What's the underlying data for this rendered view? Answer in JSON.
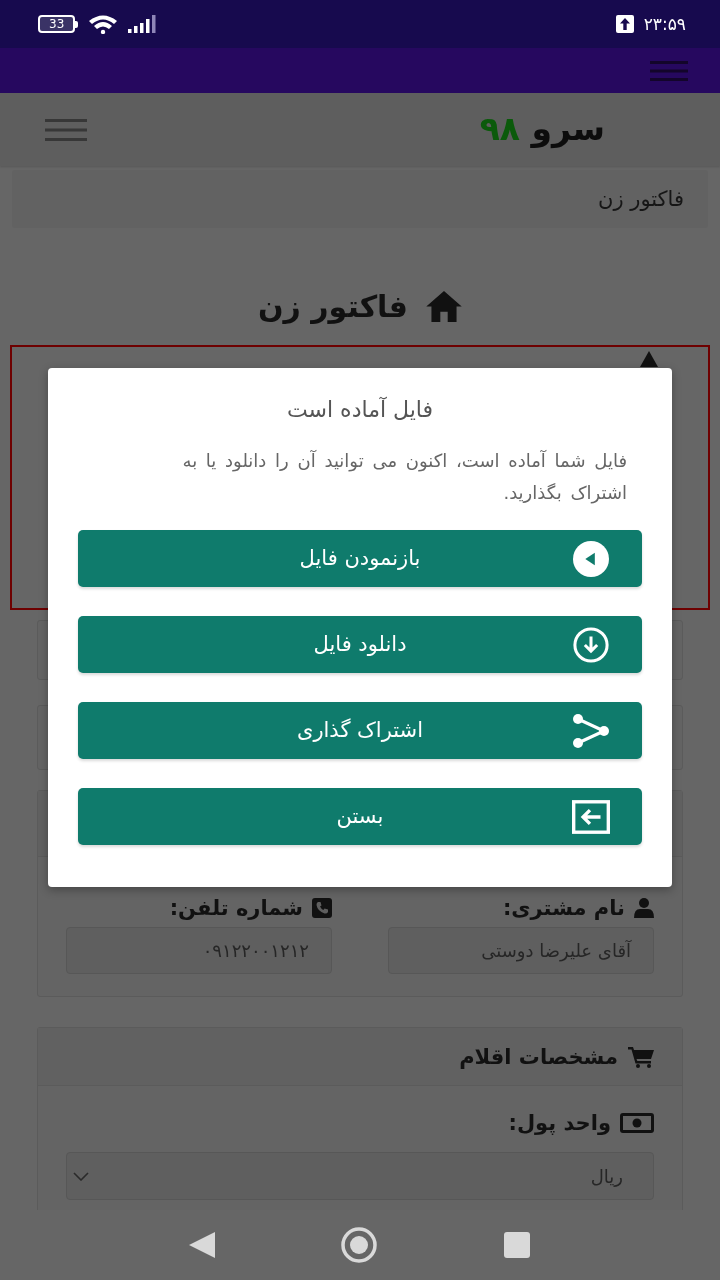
{
  "status_bar": {
    "battery": "33",
    "time": "۲۳:۵۹"
  },
  "header": {
    "logo_text": "سرو",
    "logo_number": "۹۸"
  },
  "breadcrumb": "فاکتور زن",
  "page_title": "فاکتور زن",
  "customer": {
    "fields": [
      {
        "kind": "person",
        "label": "نام مشتری:",
        "value": "آقای علیرضا دوستی"
      },
      {
        "kind": "phone",
        "label": "شماره تلفن:",
        "value": "۰۹۱۲۲۰۰۱۲۱۲"
      }
    ]
  },
  "items_section": {
    "title": "مشخصات اقلام",
    "currency_label": "واحد پول:",
    "currency_value": "ریال"
  },
  "dialog": {
    "title": "فایل آماده است",
    "message": "فایل شما آماده است، اکنون می توانید آن را دانلود یا به اشتراک بگذارید.",
    "buttons": [
      {
        "kind": "open",
        "label": "بازنمودن فایل"
      },
      {
        "kind": "download",
        "label": "دانلود فایل"
      },
      {
        "kind": "share",
        "label": "اشتراک گذاری"
      },
      {
        "kind": "close",
        "label": "بستن"
      }
    ]
  }
}
